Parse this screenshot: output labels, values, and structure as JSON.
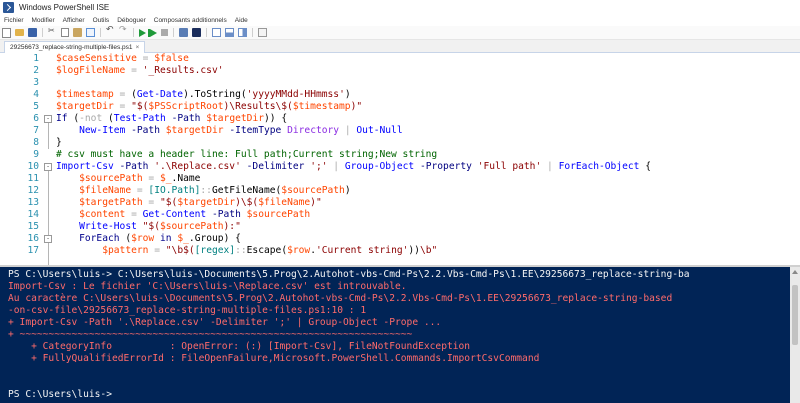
{
  "window": {
    "title": "Windows PowerShell ISE"
  },
  "menu": [
    "Fichier",
    "Modifier",
    "Afficher",
    "Outils",
    "Déboguer",
    "Composants additionnels",
    "Aide"
  ],
  "toolbar_icons": [
    "new-file-icon",
    "open-folder-icon",
    "save-icon",
    "cut-icon",
    "copy-icon",
    "paste-icon",
    "clear-icon",
    "undo-icon",
    "redo-icon",
    "run-script-icon",
    "run-selection-icon",
    "stop-icon",
    "remote-powershell-icon",
    "powershell-console-icon",
    "script-pane-top-icon",
    "script-pane-right-icon",
    "script-pane-max-icon",
    "command-addon-icon"
  ],
  "tab": {
    "label": "29256673_replace-string-multiple-files.ps1",
    "close": "×"
  },
  "editor_lines": [
    {
      "num": "1",
      "tokens": [
        [
          "t-var",
          "$caseSensitive"
        ],
        [
          "t-op",
          " = "
        ],
        [
          "t-var",
          "$false"
        ]
      ]
    },
    {
      "num": "2",
      "tokens": [
        [
          "t-var",
          "$logFileName"
        ],
        [
          "t-op",
          " = "
        ],
        [
          "t-str",
          "'_Results.csv'"
        ]
      ]
    },
    {
      "num": "3",
      "tokens": []
    },
    {
      "num": "4",
      "tokens": [
        [
          "t-var",
          "$timestamp"
        ],
        [
          "t-op",
          " = "
        ],
        [
          "t-plain",
          "("
        ],
        [
          "t-cmd",
          "Get-Date"
        ],
        [
          "t-plain",
          ")."
        ],
        [
          "t-mem",
          "ToString"
        ],
        [
          "t-plain",
          "("
        ],
        [
          "t-str",
          "'yyyyMMdd-HHmmss'"
        ],
        [
          "t-plain",
          ")"
        ]
      ]
    },
    {
      "num": "5",
      "tokens": [
        [
          "t-var",
          "$targetDir"
        ],
        [
          "t-op",
          " = "
        ],
        [
          "t-str",
          "\"$("
        ],
        [
          "t-var",
          "$PSScriptRoot"
        ],
        [
          "t-str",
          ")\\Results\\$("
        ],
        [
          "t-var",
          "$timestamp"
        ],
        [
          "t-str",
          ")\""
        ]
      ]
    },
    {
      "num": "6",
      "fold": "-",
      "tokens": [
        [
          "t-kw",
          "If"
        ],
        [
          "t-plain",
          " ("
        ],
        [
          "t-op",
          "-not"
        ],
        [
          "t-plain",
          " ("
        ],
        [
          "t-cmd",
          "Test-Path"
        ],
        [
          "t-plain",
          " "
        ],
        [
          "t-param",
          "-Path"
        ],
        [
          "t-plain",
          " "
        ],
        [
          "t-var",
          "$targetDir"
        ],
        [
          "t-plain",
          ")) {"
        ]
      ]
    },
    {
      "num": "7",
      "tokens": [
        [
          "t-plain",
          "    "
        ],
        [
          "t-cmd",
          "New-Item"
        ],
        [
          "t-plain",
          " "
        ],
        [
          "t-param",
          "-Path"
        ],
        [
          "t-plain",
          " "
        ],
        [
          "t-var",
          "$targetDir"
        ],
        [
          "t-plain",
          " "
        ],
        [
          "t-param",
          "-ItemType"
        ],
        [
          "t-plain",
          " "
        ],
        [
          "t-arg",
          "Directory"
        ],
        [
          "t-op",
          " | "
        ],
        [
          "t-cmd",
          "Out-Null"
        ]
      ]
    },
    {
      "num": "8",
      "tokens": [
        [
          "t-plain",
          "}"
        ]
      ]
    },
    {
      "num": "9",
      "tokens": [
        [
          "t-com",
          "# csv must have a header line: Full path;Current string;New string"
        ]
      ]
    },
    {
      "num": "10",
      "fold": "-",
      "tokens": [
        [
          "t-cmd",
          "Import-Csv"
        ],
        [
          "t-plain",
          " "
        ],
        [
          "t-param",
          "-Path"
        ],
        [
          "t-plain",
          " "
        ],
        [
          "t-str",
          "'.\\Replace.csv'"
        ],
        [
          "t-plain",
          " "
        ],
        [
          "t-param",
          "-Delimiter"
        ],
        [
          "t-plain",
          " "
        ],
        [
          "t-str",
          "';'"
        ],
        [
          "t-op",
          " | "
        ],
        [
          "t-cmd",
          "Group-Object"
        ],
        [
          "t-plain",
          " "
        ],
        [
          "t-param",
          "-Property"
        ],
        [
          "t-plain",
          " "
        ],
        [
          "t-str",
          "'Full path'"
        ],
        [
          "t-op",
          " | "
        ],
        [
          "t-cmd",
          "ForEach-Object"
        ],
        [
          "t-plain",
          " {"
        ]
      ]
    },
    {
      "num": "11",
      "tokens": [
        [
          "t-plain",
          "    "
        ],
        [
          "t-var",
          "$sourcePath"
        ],
        [
          "t-op",
          " = "
        ],
        [
          "t-var",
          "$_"
        ],
        [
          "t-plain",
          "."
        ],
        [
          "t-mem",
          "Name"
        ]
      ]
    },
    {
      "num": "12",
      "tokens": [
        [
          "t-plain",
          "    "
        ],
        [
          "t-var",
          "$fileName"
        ],
        [
          "t-op",
          " = "
        ],
        [
          "t-type",
          "[IO.Path]"
        ],
        [
          "t-op",
          "::"
        ],
        [
          "t-mem",
          "GetFileName"
        ],
        [
          "t-plain",
          "("
        ],
        [
          "t-var",
          "$sourcePath"
        ],
        [
          "t-plain",
          ")"
        ]
      ]
    },
    {
      "num": "13",
      "tokens": [
        [
          "t-plain",
          "    "
        ],
        [
          "t-var",
          "$targetPath"
        ],
        [
          "t-op",
          " = "
        ],
        [
          "t-str",
          "\"$("
        ],
        [
          "t-var",
          "$targetDir"
        ],
        [
          "t-str",
          ")\\$("
        ],
        [
          "t-var",
          "$fileName"
        ],
        [
          "t-str",
          ")\""
        ]
      ]
    },
    {
      "num": "14",
      "tokens": [
        [
          "t-plain",
          "    "
        ],
        [
          "t-var",
          "$content"
        ],
        [
          "t-op",
          " = "
        ],
        [
          "t-cmd",
          "Get-Content"
        ],
        [
          "t-plain",
          " "
        ],
        [
          "t-param",
          "-Path"
        ],
        [
          "t-plain",
          " "
        ],
        [
          "t-var",
          "$sourcePath"
        ]
      ]
    },
    {
      "num": "15",
      "tokens": [
        [
          "t-plain",
          "    "
        ],
        [
          "t-cmd",
          "Write-Host"
        ],
        [
          "t-plain",
          " "
        ],
        [
          "t-str",
          "\"$("
        ],
        [
          "t-var",
          "$sourcePath"
        ],
        [
          "t-str",
          "):\""
        ]
      ]
    },
    {
      "num": "16",
      "fold": "-",
      "tokens": [
        [
          "t-plain",
          "    "
        ],
        [
          "t-kw",
          "ForEach"
        ],
        [
          "t-plain",
          " ("
        ],
        [
          "t-var",
          "$row"
        ],
        [
          "t-plain",
          " "
        ],
        [
          "t-kw",
          "in"
        ],
        [
          "t-plain",
          " "
        ],
        [
          "t-var",
          "$_"
        ],
        [
          "t-plain",
          "."
        ],
        [
          "t-mem",
          "Group"
        ],
        [
          "t-plain",
          ") {"
        ]
      ]
    },
    {
      "num": "17",
      "tokens": [
        [
          "t-plain",
          "        "
        ],
        [
          "t-var",
          "$pattern"
        ],
        [
          "t-op",
          " = "
        ],
        [
          "t-str",
          "\"\\b$("
        ],
        [
          "t-type",
          "[regex]"
        ],
        [
          "t-op",
          "::"
        ],
        [
          "t-mem",
          "Escape"
        ],
        [
          "t-plain",
          "("
        ],
        [
          "t-var",
          "$row"
        ],
        [
          "t-plain",
          "."
        ],
        [
          "t-str",
          "'Current string'"
        ],
        [
          "t-plain",
          "))"
        ],
        [
          "t-str",
          "\\b\""
        ]
      ]
    }
  ],
  "console_lines": [
    {
      "cls": "c-white",
      "text": "PS C:\\Users\\luis-> C:\\Users\\luis-\\Documents\\5.Prog\\2.Autohot-vbs-Cmd-Ps\\2.2.Vbs-Cmd-Ps\\1.EE\\29256673_replace-string-ba"
    },
    {
      "cls": "c-red",
      "text": "Import-Csv : Le fichier 'C:\\Users\\luis-\\Replace.csv' est introuvable."
    },
    {
      "cls": "c-red",
      "text": "Au caractère C:\\Users\\luis-\\Documents\\5.Prog\\2.Autohot-vbs-Cmd-Ps\\2.2.Vbs-Cmd-Ps\\1.EE\\29256673_replace-string-based"
    },
    {
      "cls": "c-red",
      "text": "-on-csv-file\\29256673_replace-string-multiple-files.ps1:10 : 1"
    },
    {
      "cls": "c-red",
      "text": "+ Import-Csv -Path '.\\Replace.csv' -Delimiter ';' | Group-Object -Prope ..."
    },
    {
      "cls": "c-red",
      "text": "+ ~~~~~~~~~~~~~~~~~~~~~~~~~~~~~~~~~~~~~~~~~~~~~~~~~~~~~~~~~~~~~~~~~~~~"
    },
    {
      "cls": "c-red",
      "text": "    + CategoryInfo          : OpenError: (:) [Import-Csv], FileNotFoundException"
    },
    {
      "cls": "c-red",
      "text": "    + FullyQualifiedErrorId : FileOpenFailure,Microsoft.PowerShell.Commands.ImportCsvCommand"
    },
    {
      "cls": "c-white",
      "text": " "
    },
    {
      "cls": "c-white",
      "text": " "
    },
    {
      "cls": "c-white",
      "text": "PS C:\\Users\\luis->"
    }
  ]
}
